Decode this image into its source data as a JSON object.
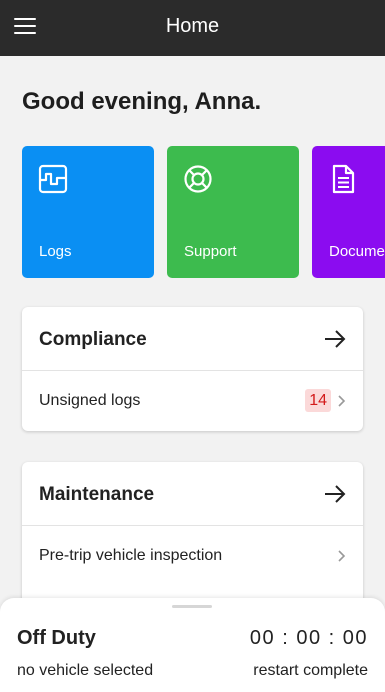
{
  "appbar": {
    "title": "Home",
    "menu_icon": "hamburger-menu-icon",
    "background": "#2b2b2b"
  },
  "greeting": "Good evening, Anna.",
  "tiles": [
    {
      "label": "Logs",
      "icon": "logs-icon",
      "color": "#0a8ff3"
    },
    {
      "label": "Support",
      "icon": "lifebuoy-icon",
      "color": "#3dbb4e"
    },
    {
      "label": "Documents",
      "icon": "document-icon",
      "color": "#8b0cf0"
    }
  ],
  "compliance": {
    "title": "Compliance",
    "items": [
      {
        "label": "Unsigned logs",
        "badge": "14",
        "badge_color": "#d31a1a"
      }
    ]
  },
  "maintenance": {
    "title": "Maintenance",
    "items": [
      {
        "label": "Pre-trip vehicle inspection"
      }
    ]
  },
  "status_sheet": {
    "status": "Off Duty",
    "timer": "00:00:00",
    "vehicle": "no vehicle selected",
    "restart": "restart complete"
  }
}
